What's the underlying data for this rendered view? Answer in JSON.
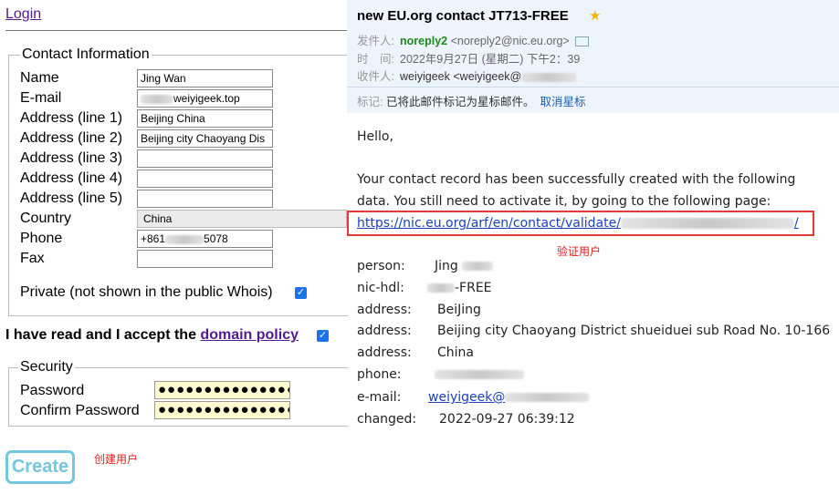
{
  "form": {
    "login_link": "Login",
    "contact_legend": "Contact Information",
    "fields": [
      {
        "label": "Name",
        "value": "Jing Wan"
      },
      {
        "label": "E-mail",
        "value": "weiyigeek.top"
      },
      {
        "label": "Address (line 1)",
        "value": "Beijing China"
      },
      {
        "label": "Address (line 2)",
        "value": "Beijing city Chaoyang Dis"
      },
      {
        "label": "Address (line 3)",
        "value": ""
      },
      {
        "label": "Address (line 4)",
        "value": ""
      },
      {
        "label": "Address (line 5)",
        "value": ""
      },
      {
        "label": "Country",
        "value": "China"
      },
      {
        "label": "Phone",
        "value": "+861",
        "value_tail": "5078"
      },
      {
        "label": "Fax",
        "value": ""
      }
    ],
    "private_label": "Private (not shown in the public Whois)",
    "accept_text": "I have read and I accept the",
    "domain_policy_link": "domain policy",
    "security_legend": "Security",
    "password_label": "Password",
    "password_value": "●●●●●●●●●●●●●●●",
    "confirm_label": "Confirm Password",
    "confirm_value": "●●●●●●●●●●●●●●●",
    "create_button": "Create",
    "create_note": "创建用户"
  },
  "email": {
    "subject": "new EU.org contact JT713-FREE",
    "from_label": "发件人:",
    "from_name": "noreply2",
    "from_address": "<noreply2@nic.eu.org>",
    "time_label": "时　间:",
    "time_value": "2022年9月27日 (星期二) 下午2：39",
    "to_label": "收件人:",
    "to_value": "weiyigeek <weiyigeek@",
    "tag_label": "标记:",
    "tag_text": "已将此邮件标记为星标邮件。",
    "unstar_link": "取消星标",
    "greeting": "Hello,",
    "line1": "Your contact record has been successfully created with the following",
    "line2": "data. You still need to activate it, by going to the following page:",
    "activation_link": "https://nic.eu.org/arf/en/contact/validate/",
    "verify_note": "验证用户",
    "record": [
      {
        "key": "person:",
        "value": "Jing"
      },
      {
        "key": "nic-hdl:",
        "value": "-FREE"
      },
      {
        "key": "address:",
        "value": "BeiJing"
      },
      {
        "key": "address:",
        "value": "Beijing city Chaoyang District shueiduei sub Road No. 10-166"
      },
      {
        "key": "address:",
        "value": "China"
      },
      {
        "key": "phone:",
        "value": ""
      },
      {
        "key": "e-mail:",
        "value": "weiyigeek@"
      },
      {
        "key": "changed:",
        "value": "2022-09-27 06:39:12"
      }
    ]
  },
  "colors": {
    "accent_red": "#e53935",
    "create_button": "#72c7dd",
    "checkbox": "#1a73e8",
    "link": "#551a8b"
  },
  "icons": [
    "star-icon",
    "contact-card-icon",
    "checkbox-checked-icon"
  ]
}
